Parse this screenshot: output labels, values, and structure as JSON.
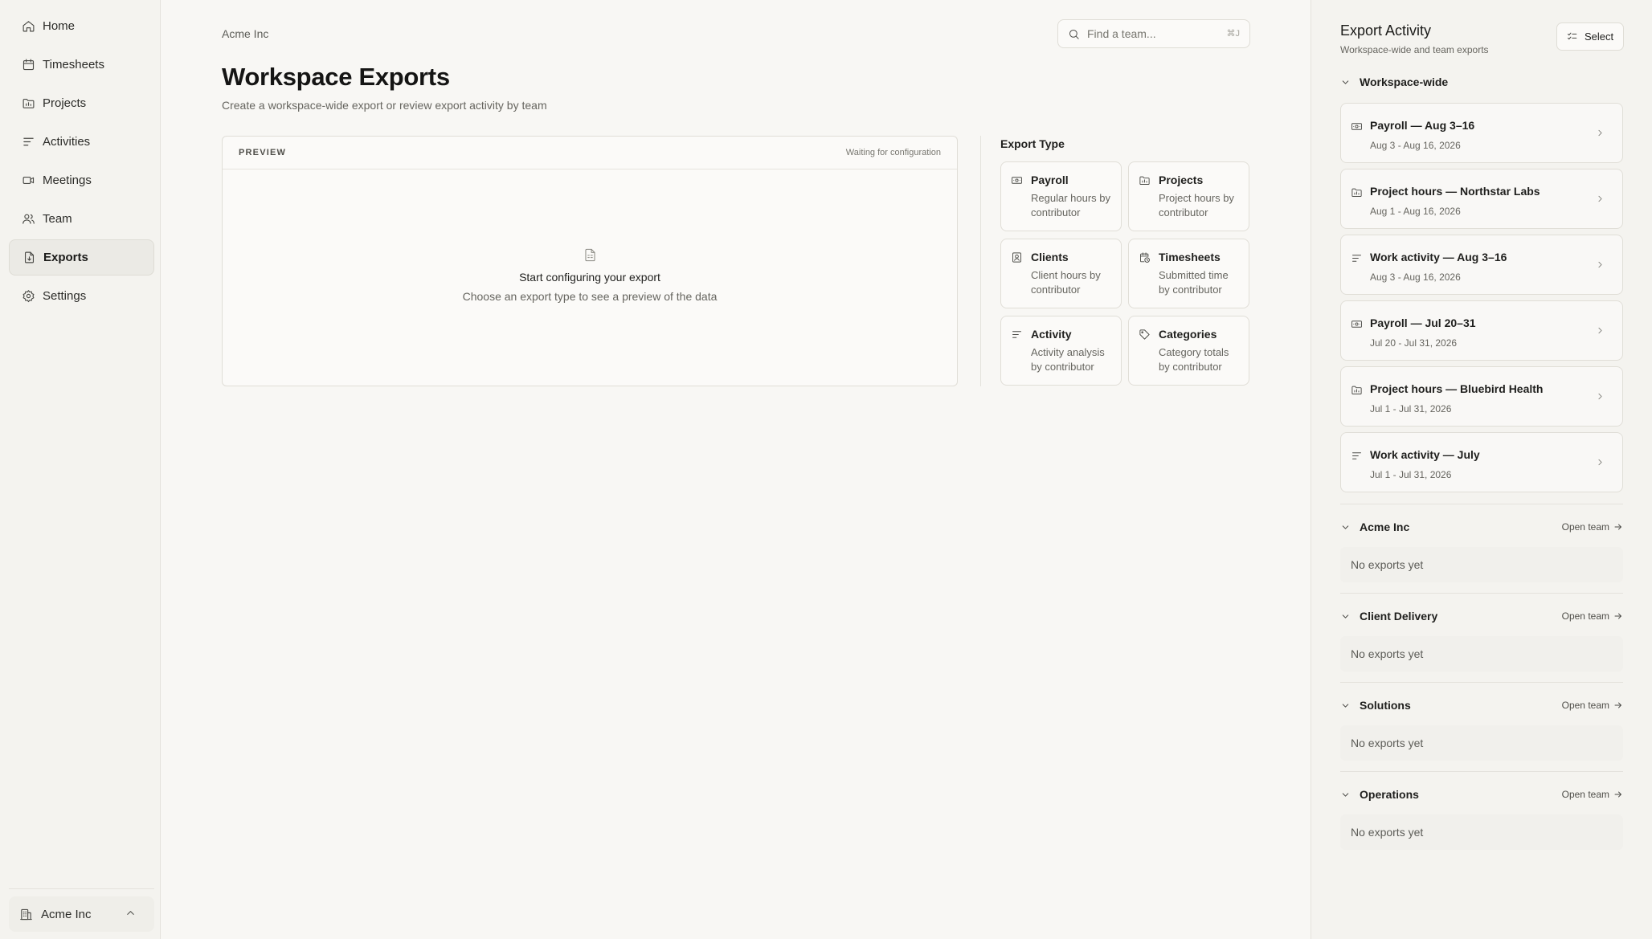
{
  "sidebar": {
    "items": [
      {
        "label": "Home",
        "icon": "home-icon",
        "active": false
      },
      {
        "label": "Timesheets",
        "icon": "calendar-icon",
        "active": false
      },
      {
        "label": "Projects",
        "icon": "folder-icon",
        "active": false
      },
      {
        "label": "Activities",
        "icon": "lines-icon",
        "active": false
      },
      {
        "label": "Meetings",
        "icon": "video-icon",
        "active": false
      },
      {
        "label": "Team",
        "icon": "users-icon",
        "active": false
      },
      {
        "label": "Exports",
        "icon": "file-export-icon",
        "active": true
      },
      {
        "label": "Settings",
        "icon": "gear-icon",
        "active": false
      }
    ],
    "workspace_label": "Acme Inc"
  },
  "header": {
    "breadcrumb": "Acme Inc",
    "search_placeholder": "Find a team...",
    "search_shortcut": "⌘J",
    "title": "Workspace Exports",
    "subtitle": "Create a workspace-wide export or review export activity by team"
  },
  "preview": {
    "label": "PREVIEW",
    "status": "Waiting for configuration",
    "empty_title": "Start configuring your export",
    "empty_subtitle": "Choose an export type to see a preview of the data"
  },
  "export_type": {
    "heading": "Export Type",
    "options": [
      {
        "name": "Payroll",
        "desc": "Regular hours by contributor",
        "icon": "payroll-icon"
      },
      {
        "name": "Projects",
        "desc": "Project hours by contributor",
        "icon": "folder-icon"
      },
      {
        "name": "Clients",
        "desc": "Client hours by contributor",
        "icon": "client-icon"
      },
      {
        "name": "Timesheets",
        "desc": "Submitted time by contributor",
        "icon": "timesheet-icon"
      },
      {
        "name": "Activity",
        "desc": "Activity analysis by contributor",
        "icon": "lines-icon"
      },
      {
        "name": "Categories",
        "desc": "Category totals by contributor",
        "icon": "tag-icon"
      }
    ]
  },
  "activity": {
    "title": "Export Activity",
    "subtitle": "Workspace-wide and team exports",
    "select_label": "Select",
    "workspace_group": "Workspace-wide",
    "exports": [
      {
        "title": "Payroll — Aug 3–16",
        "range": "Aug 3 - Aug 16, 2026",
        "icon": "payroll-icon"
      },
      {
        "title": "Project hours — Northstar Labs",
        "range": "Aug 1 - Aug 16, 2026",
        "icon": "folder-icon"
      },
      {
        "title": "Work activity — Aug 3–16",
        "range": "Aug 3 - Aug 16, 2026",
        "icon": "lines-icon"
      },
      {
        "title": "Payroll — Jul 20–31",
        "range": "Jul 20 - Jul 31, 2026",
        "icon": "payroll-icon"
      },
      {
        "title": "Project hours — Bluebird Health",
        "range": "Jul 1 - Jul 31, 2026",
        "icon": "folder-icon"
      },
      {
        "title": "Work activity — July",
        "range": "Jul 1 - Jul 31, 2026",
        "icon": "lines-icon"
      }
    ],
    "teams": [
      {
        "name": "Acme Inc",
        "open_label": "Open team",
        "empty": "No exports yet"
      },
      {
        "name": "Client Delivery",
        "open_label": "Open team",
        "empty": "No exports yet"
      },
      {
        "name": "Solutions",
        "open_label": "Open team",
        "empty": "No exports yet"
      },
      {
        "name": "Operations",
        "open_label": "Open team",
        "empty": "No exports yet"
      }
    ]
  }
}
